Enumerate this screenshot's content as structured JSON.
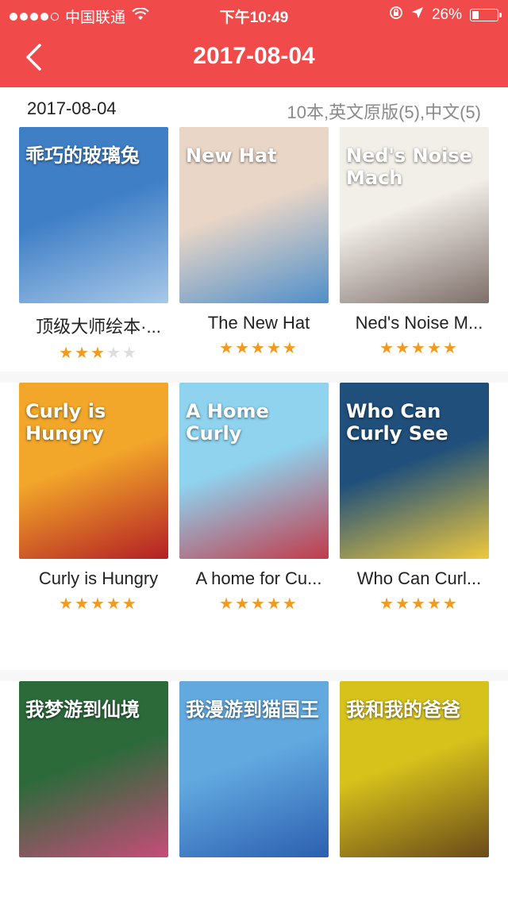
{
  "status": {
    "carrier": "中国联通",
    "time": "下午10:49",
    "battery": "26%"
  },
  "nav": {
    "title": "2017-08-04"
  },
  "subhead": {
    "date": "2017-08-04",
    "summary": "10本,英文原版(5),中文(5)"
  },
  "books": [
    {
      "title": "顶级大师绘本·...",
      "rating": 3,
      "cover_text": "乖巧的玻璃兔",
      "colors": [
        "#3f7fc6",
        "#a8c8e8"
      ]
    },
    {
      "title": "The New Hat",
      "rating": 5,
      "cover_text": "New Hat",
      "colors": [
        "#e9d6c7",
        "#4f8fca"
      ]
    },
    {
      "title": "Ned's Noise M...",
      "rating": 5,
      "cover_text": "Ned's Noise Mach",
      "colors": [
        "#f2eee8",
        "#7e6f6a"
      ]
    },
    {
      "title": "Curly is Hungry",
      "rating": 5,
      "cover_text": "Curly is Hungry",
      "colors": [
        "#f2a72a",
        "#b31f25"
      ]
    },
    {
      "title": "A home for Cu...",
      "rating": 5,
      "cover_text": "A Home Curly",
      "colors": [
        "#8fd3ef",
        "#c23a4a"
      ]
    },
    {
      "title": "Who Can  Curl...",
      "rating": 5,
      "cover_text": "Who Can Curly See",
      "colors": [
        "#1f4f7a",
        "#f0c83c"
      ]
    },
    {
      "title": "",
      "rating": 0,
      "cover_text": "我梦游到仙境",
      "colors": [
        "#2c6a3a",
        "#c74c7a"
      ]
    },
    {
      "title": "",
      "rating": 0,
      "cover_text": "我漫游到猫国王",
      "colors": [
        "#62a9e0",
        "#2c5fb0"
      ]
    },
    {
      "title": "",
      "rating": 0,
      "cover_text": "我和我的爸爸",
      "colors": [
        "#d7c21c",
        "#6a4a1a"
      ]
    }
  ]
}
